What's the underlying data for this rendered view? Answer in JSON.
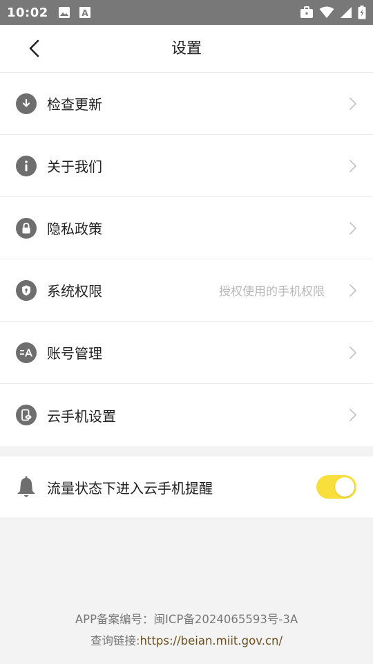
{
  "status_bar": {
    "time": "10:02",
    "left_icons": [
      "image-icon",
      "text-a-icon"
    ],
    "right_icons": [
      "briefcase-icon",
      "wifi-icon",
      "signal-icon",
      "battery-charging-icon"
    ]
  },
  "header": {
    "title": "设置",
    "back_icon": "chevron-left-icon"
  },
  "settings": {
    "items": [
      {
        "label": "检查更新",
        "icon": "download-icon",
        "hint": ""
      },
      {
        "label": "关于我们",
        "icon": "info-icon",
        "hint": ""
      },
      {
        "label": "隐私政策",
        "icon": "lock-icon",
        "hint": ""
      },
      {
        "label": "系统权限",
        "icon": "shield-icon",
        "hint": "授权使用的手机权限"
      },
      {
        "label": "账号管理",
        "icon": "account-icon",
        "hint": ""
      },
      {
        "label": "云手机设置",
        "icon": "cloud-phone-icon",
        "hint": ""
      }
    ]
  },
  "notify": {
    "label": "流量状态下进入云手机提醒",
    "icon": "bell-icon",
    "enabled": true
  },
  "footer": {
    "icp_line": "APP备案编号：闽ICP备2024065593号-3A",
    "query_prefix": "查询链接:",
    "query_link": "https://beian.miit.gov.cn/"
  },
  "colors": {
    "status_bar": "#787878",
    "toggle_on": "#f8df3b",
    "icon_gray": "#6e6e6e",
    "link": "#6b4f1e"
  }
}
